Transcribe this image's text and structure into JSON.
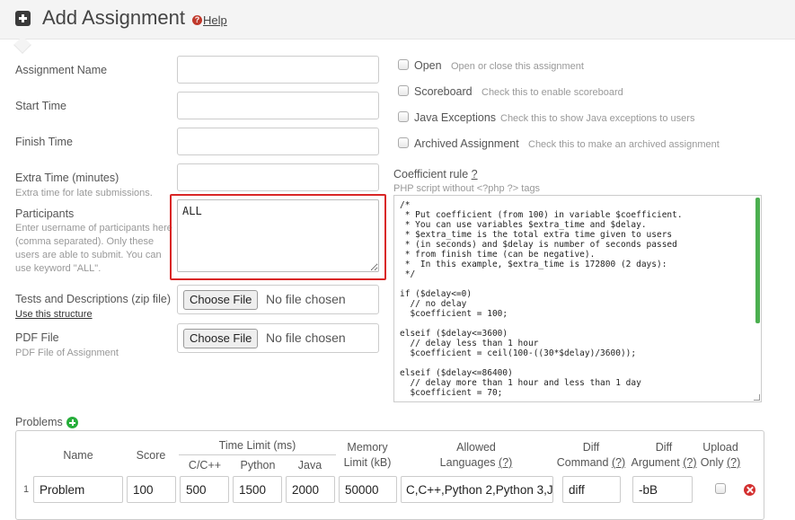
{
  "header": {
    "title": "Add Assignment",
    "help_label": "Help",
    "help_icon_glyph": "?"
  },
  "form": {
    "assignment_name": {
      "label": "Assignment Name",
      "value": ""
    },
    "start_time": {
      "label": "Start Time",
      "value": ""
    },
    "finish_time": {
      "label": "Finish Time",
      "value": ""
    },
    "extra_time": {
      "label": "Extra Time (minutes)",
      "sub": "Extra time for late submissions.",
      "value": ""
    },
    "participants": {
      "label": "Participants",
      "sub": "Enter username of participants here (comma separated). Only these users are able to submit. You can use keyword \"ALL\".",
      "value": "ALL"
    },
    "tests": {
      "label": "Tests and Descriptions (zip file)",
      "link": "Use this structure",
      "button": "Choose File",
      "status": "No file chosen"
    },
    "pdf": {
      "label": "PDF File",
      "sub": "PDF File of Assignment",
      "button": "Choose File",
      "status": "No file chosen"
    }
  },
  "options": [
    {
      "label": "Open",
      "desc": "Open or close this assignment",
      "checked": false
    },
    {
      "label": "Scoreboard",
      "desc": "Check this to enable scoreboard",
      "checked": false
    },
    {
      "label": "Java Exceptions",
      "desc": "Check this to show Java exceptions to users",
      "checked": false
    },
    {
      "label": "Archived Assignment",
      "desc": "Check this to make an archived assignment",
      "checked": false
    }
  ],
  "coefficient": {
    "label": "Coefficient rule",
    "help": "?",
    "sub": "PHP script without <?php ?> tags",
    "code": "/*\n * Put coefficient (from 100) in variable $coefficient.\n * You can use variables $extra_time and $delay.\n * $extra_time is the total extra time given to users\n * (in seconds) and $delay is number of seconds passed\n * from finish time (can be negative).\n *  In this example, $extra_time is 172800 (2 days):\n */\n\nif ($delay<=0)\n  // no delay\n  $coefficient = 100;\n\nelseif ($delay<=3600)\n  // delay less than 1 hour\n  $coefficient = ceil(100-((30*$delay)/3600));\n\nelseif ($delay<=86400)\n  // delay more than 1 hour and less than 1 day\n  $coefficient = 70;"
  },
  "problems": {
    "label": "Problems",
    "headers": {
      "name": "Name",
      "score": "Score",
      "time_limit": "Time Limit (ms)",
      "c_cpp": "C/C++",
      "python": "Python",
      "java": "Java",
      "memory_1": "Memory",
      "memory_2": "Limit (kB)",
      "allowed_1": "Allowed",
      "allowed_2": "Languages",
      "diff_cmd_1": "Diff",
      "diff_cmd_2": "Command",
      "diff_arg_1": "Diff",
      "diff_arg_2": "Argument",
      "upload_1": "Upload",
      "upload_2": "Only",
      "q": "(?)"
    },
    "rows": [
      {
        "num": "1",
        "name": "Problem",
        "score": "100",
        "c_cpp": "500",
        "python": "1500",
        "java": "2000",
        "memory": "50000",
        "languages": "C,C++,Python 2,Python 3,J",
        "diff_cmd": "diff",
        "diff_arg": "-bB",
        "upload_only": false
      }
    ]
  }
}
